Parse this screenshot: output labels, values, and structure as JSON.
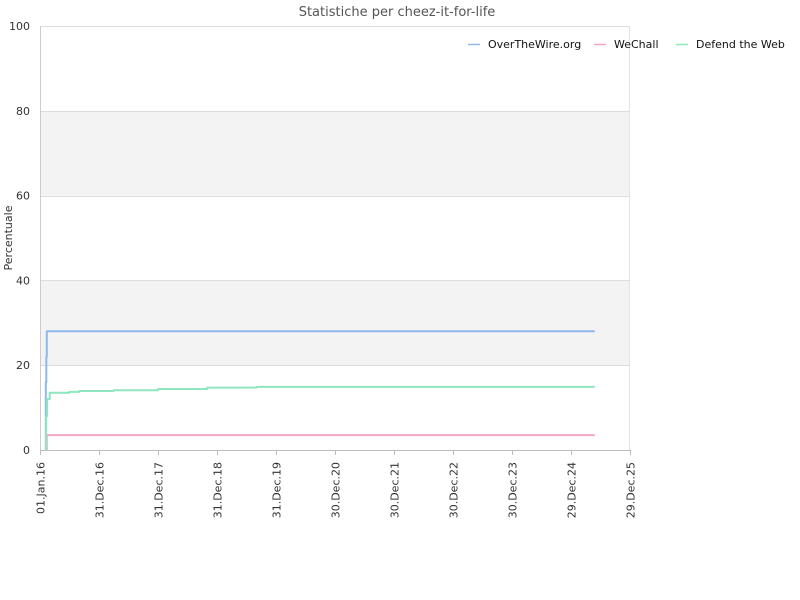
{
  "chart_data": {
    "type": "line",
    "title": "Statistiche per cheez-it-for-life",
    "xlabel": "",
    "ylabel": "Percentuale",
    "ylim": [
      0,
      100
    ],
    "yticks": [
      0,
      20,
      40,
      60,
      80,
      100
    ],
    "xlim": [
      "2016-01-01",
      "2025-12-29"
    ],
    "xticks": [
      {
        "date": "2016-01-01",
        "label": "01.Jan.16"
      },
      {
        "date": "2016-12-31",
        "label": "31.Dec.16"
      },
      {
        "date": "2017-12-31",
        "label": "31.Dec.17"
      },
      {
        "date": "2018-12-31",
        "label": "31.Dec.18"
      },
      {
        "date": "2019-12-31",
        "label": "31.Dec.19"
      },
      {
        "date": "2020-12-30",
        "label": "30.Dec.20"
      },
      {
        "date": "2021-12-30",
        "label": "30.Dec.21"
      },
      {
        "date": "2022-12-30",
        "label": "30.Dec.22"
      },
      {
        "date": "2023-12-30",
        "label": "30.Dec.23"
      },
      {
        "date": "2024-12-29",
        "label": "29.Dec.24"
      },
      {
        "date": "2025-12-29",
        "label": "29.Dec.25"
      }
    ],
    "grid": true,
    "legend_position": "top-right",
    "series": [
      {
        "name": "OverTheWire.org",
        "color": "#8fb8ec",
        "points": [
          {
            "x": "2016-02-05",
            "y": 0
          },
          {
            "x": "2016-02-06",
            "y": 16
          },
          {
            "x": "2016-02-09",
            "y": 22
          },
          {
            "x": "2016-02-12",
            "y": 28
          },
          {
            "x": "2025-05-25",
            "y": 28
          }
        ]
      },
      {
        "name": "WeChall",
        "color": "#f2a8c4",
        "points": [
          {
            "x": "2016-02-10",
            "y": 0
          },
          {
            "x": "2016-02-12",
            "y": 3.5
          },
          {
            "x": "2025-05-25",
            "y": 3.5
          }
        ]
      },
      {
        "name": "Defend the Web",
        "color": "#8fe6bf",
        "points": [
          {
            "x": "2016-02-05",
            "y": 0
          },
          {
            "x": "2016-02-08",
            "y": 8
          },
          {
            "x": "2016-02-14",
            "y": 12
          },
          {
            "x": "2016-03-01",
            "y": 13.5
          },
          {
            "x": "2016-07-01",
            "y": 13.7
          },
          {
            "x": "2016-09-01",
            "y": 13.9
          },
          {
            "x": "2017-04-01",
            "y": 14.1
          },
          {
            "x": "2018-01-01",
            "y": 14.4
          },
          {
            "x": "2018-11-01",
            "y": 14.7
          },
          {
            "x": "2019-09-01",
            "y": 14.9
          },
          {
            "x": "2025-05-25",
            "y": 14.9
          }
        ]
      }
    ]
  }
}
